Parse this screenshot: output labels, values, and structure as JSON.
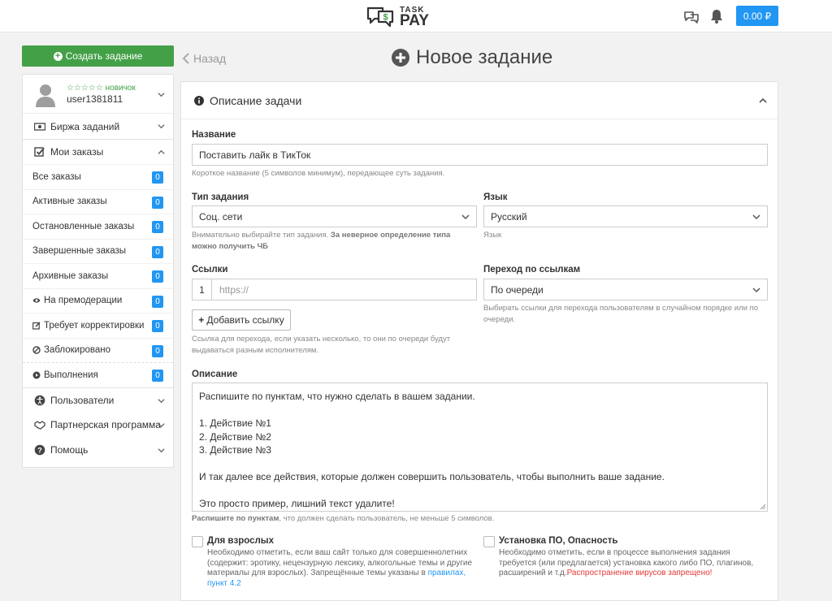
{
  "header": {
    "logo_top": "TASK",
    "logo_bottom": "PAY",
    "balance": "0.00 ₽"
  },
  "sidebar": {
    "create_button": "Создать задание",
    "user": {
      "rank": "новичок",
      "name": "user1381811"
    },
    "menu": {
      "exchange": "Биржа заданий",
      "my_orders": "Мои заказы",
      "users": "Пользователи",
      "partner": "Партнерская программа",
      "help": "Помощь"
    },
    "orders": [
      {
        "label": "Все заказы",
        "count": "0"
      },
      {
        "label": "Активные заказы",
        "count": "0"
      },
      {
        "label": "Остановленные заказы",
        "count": "0"
      },
      {
        "label": "Завершенные заказы",
        "count": "0"
      },
      {
        "label": "Архивные заказы",
        "count": "0"
      },
      {
        "label": "На премодерации",
        "count": "0"
      },
      {
        "label": "Требует корректировки",
        "count": "0"
      },
      {
        "label": "Заблокировано",
        "count": "0"
      }
    ],
    "executions": {
      "label": "Выполнения",
      "count": "0"
    }
  },
  "main": {
    "back": "Назад",
    "title": "Новое задание",
    "section": "Описание задачи",
    "name_label": "Название",
    "name_value": "Поставить лайк в ТикТок",
    "name_hint": "Короткое название (5 символов минимум), передающее суть задания.",
    "type_label": "Тип задания",
    "type_value": "Соц. сети",
    "type_hint_a": "Внимательно выбирайте тип задания. ",
    "type_hint_b": "За неверное определение типа можно получить ЧБ",
    "lang_label": "Язык",
    "lang_value": "Русский",
    "lang_hint": "Язык",
    "links_label": "Ссылки",
    "link_index": "1",
    "link_placeholder": "https://",
    "add_link": "Добавить ссылку",
    "links_hint": "Ссылка для перехода, если указать несколько, то они по очереди будут выдаваться разным исполнителям.",
    "nav_label": "Переход по ссылкам",
    "nav_value": "По очереди",
    "nav_hint": "Выбирать ссылки для перехода пользователям в случайном порядке или по очереди.",
    "desc_label": "Описание",
    "desc_text": "Распишите по пунктам, что нужно сделать в вашем задании.\n\n1. Действие №1\n2. Действие №2\n3. Действие №3\n\nИ так далее все действия, которые должен совершить пользователь, чтобы выполнить ваше задание.\n\nЭто просто пример, лишний текст удалите!",
    "desc_hint_a": "Распишите по пунктам",
    "desc_hint_b": ", что должен сделать пользователь, не меньше 5 символов.",
    "adult_title": "Для взрослых",
    "adult_text": "Необходимо отметить, если ваш сайт только для совершеннолетних (содержит: эротику, нецензурную лексику, алкогольные темы и другие материалы для взрослых). Запрещённые темы указаны в ",
    "adult_link": "правилах, пункт 4.2",
    "software_title": "Установка ПО, Опасность",
    "software_text": "Необходимо отметить, если в процессе выполнения задания требуется (или предлагается) установка какого либо ПО, плагинов, расширений и т.д.",
    "software_warning": "Распространение вирусов запрещено!"
  },
  "colors": {
    "primary": "#2196f3",
    "success": "#43a047",
    "danger": "#e53935"
  }
}
